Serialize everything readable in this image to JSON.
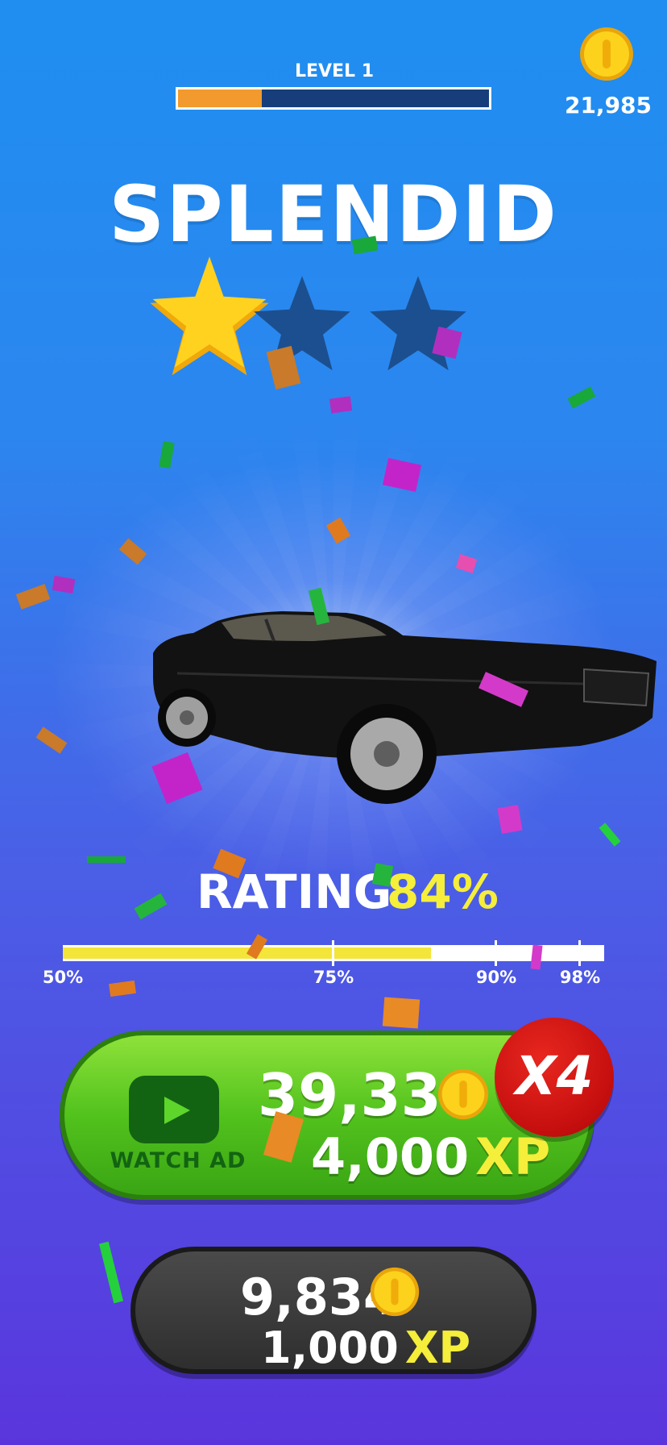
{
  "header": {
    "level_label": "LEVEL 1",
    "level_progress": 0.27,
    "coin_balance": "21,985"
  },
  "result": {
    "title": "SPLENDID",
    "stars_earned": 1,
    "stars_total": 3
  },
  "rating": {
    "label": "RATING",
    "value": "84%",
    "fill_percent": 84,
    "markers": [
      "50%",
      "75%",
      "90%",
      "98%"
    ]
  },
  "watch_ad": {
    "label": "WATCH AD",
    "coins": "39,336",
    "xp": "4,000",
    "xp_unit": "XP",
    "multiplier": "X4"
  },
  "claim": {
    "coins": "9,834",
    "xp": "1,000",
    "xp_unit": "XP"
  },
  "colors": {
    "accent_orange": "#f29a2e",
    "rating_yellow": "#f5ee3a",
    "green_button": "#52c21d",
    "badge_red": "#c40e0e"
  }
}
